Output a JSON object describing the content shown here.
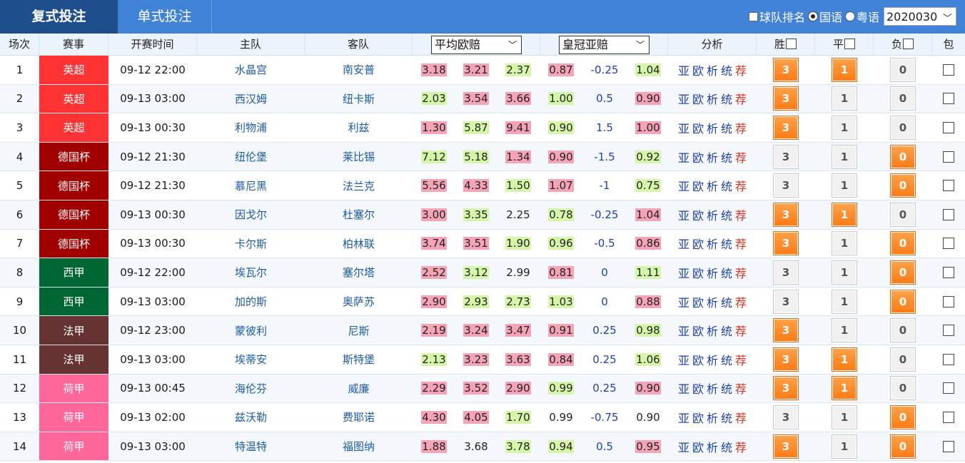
{
  "tabs": {
    "active": "复式投注",
    "inactive": "单式投注"
  },
  "top_right": {
    "team_rank_label": "球队排名",
    "lang_mandarin": "国语",
    "lang_cantonese": "粤语",
    "issue_value": "2020030"
  },
  "headers": {
    "match_no": "场次",
    "league": "赛事",
    "kickoff": "开赛时间",
    "home": "主队",
    "away": "客队",
    "euro_select": "平均欧赔",
    "asia_select": "皇冠亚赔",
    "analysis": "分析",
    "win": "胜",
    "draw": "平",
    "lose": "负",
    "bao": "包"
  },
  "analysis_links": [
    "亚",
    "欧",
    "析",
    "统",
    "荐"
  ],
  "league_colors": {
    "英超": "#ff3333",
    "德国杯": "#a10000",
    "西甲": "#006633",
    "法甲": "#663333",
    "荷甲": "#ff6699"
  },
  "rows": [
    {
      "no": "1",
      "league": "英超",
      "time": "09-12 22:00",
      "home": "水晶宫",
      "away": "南安普",
      "eu": [
        "3.18",
        "3.21",
        "2.37"
      ],
      "eu_hl": [
        "p",
        "p",
        "g"
      ],
      "as": [
        "0.87",
        "-0.25",
        "1.04"
      ],
      "as_hl": [
        "p",
        "g"
      ],
      "win": "3",
      "draw": "1",
      "lose": "0",
      "sel": [
        true,
        true,
        false
      ]
    },
    {
      "no": "2",
      "league": "英超",
      "time": "09-13 03:00",
      "home": "西汉姆",
      "away": "纽卡斯",
      "eu": [
        "2.03",
        "3.54",
        "3.66"
      ],
      "eu_hl": [
        "g",
        "p",
        "p"
      ],
      "as": [
        "1.00",
        "0.5",
        "0.90"
      ],
      "as_hl": [
        "g",
        "p"
      ],
      "win": "3",
      "draw": "1",
      "lose": "0",
      "sel": [
        true,
        false,
        false
      ]
    },
    {
      "no": "3",
      "league": "英超",
      "time": "09-13 00:30",
      "home": "利物浦",
      "away": "利兹",
      "eu": [
        "1.30",
        "5.87",
        "9.41"
      ],
      "eu_hl": [
        "p",
        "g",
        "p"
      ],
      "as": [
        "0.90",
        "1.5",
        "1.00"
      ],
      "as_hl": [
        "g",
        "p"
      ],
      "win": "3",
      "draw": "1",
      "lose": "0",
      "sel": [
        true,
        false,
        false
      ]
    },
    {
      "no": "4",
      "league": "德国杯",
      "time": "09-12 21:30",
      "home": "纽伦堡",
      "away": "莱比锡",
      "eu": [
        "7.12",
        "5.18",
        "1.34"
      ],
      "eu_hl": [
        "g",
        "g",
        "p"
      ],
      "as": [
        "0.90",
        "-1.5",
        "0.92"
      ],
      "as_hl": [
        "p",
        "g"
      ],
      "win": "3",
      "draw": "1",
      "lose": "0",
      "sel": [
        false,
        false,
        true
      ]
    },
    {
      "no": "5",
      "league": "德国杯",
      "time": "09-12 21:30",
      "home": "慕尼黑",
      "away": "法兰克",
      "eu": [
        "5.56",
        "4.33",
        "1.50"
      ],
      "eu_hl": [
        "p",
        "p",
        "g"
      ],
      "as": [
        "1.07",
        "-1",
        "0.75"
      ],
      "as_hl": [
        "p",
        "g"
      ],
      "win": "3",
      "draw": "1",
      "lose": "0",
      "sel": [
        false,
        false,
        true
      ]
    },
    {
      "no": "6",
      "league": "德国杯",
      "time": "09-13 00:30",
      "home": "因戈尔",
      "away": "杜塞尔",
      "eu": [
        "3.00",
        "3.35",
        "2.25"
      ],
      "eu_hl": [
        "p",
        "g",
        ""
      ],
      "as": [
        "0.78",
        "-0.25",
        "1.04"
      ],
      "as_hl": [
        "g",
        "p"
      ],
      "win": "3",
      "draw": "1",
      "lose": "0",
      "sel": [
        true,
        true,
        false
      ]
    },
    {
      "no": "7",
      "league": "德国杯",
      "time": "09-13 00:30",
      "home": "卡尔斯",
      "away": "柏林联",
      "eu": [
        "3.74",
        "3.51",
        "1.90"
      ],
      "eu_hl": [
        "p",
        "p",
        "g"
      ],
      "as": [
        "0.96",
        "-0.5",
        "0.86"
      ],
      "as_hl": [
        "g",
        "p"
      ],
      "win": "3",
      "draw": "1",
      "lose": "0",
      "sel": [
        true,
        false,
        true
      ]
    },
    {
      "no": "8",
      "league": "西甲",
      "time": "09-12 22:00",
      "home": "埃瓦尔",
      "away": "塞尔塔",
      "eu": [
        "2.52",
        "3.12",
        "2.99"
      ],
      "eu_hl": [
        "p",
        "g",
        ""
      ],
      "as": [
        "0.81",
        "0",
        "1.11"
      ],
      "as_hl": [
        "p",
        "g"
      ],
      "win": "3",
      "draw": "1",
      "lose": "0",
      "sel": [
        false,
        false,
        true
      ]
    },
    {
      "no": "9",
      "league": "西甲",
      "time": "09-13 03:00",
      "home": "加的斯",
      "away": "奥萨苏",
      "eu": [
        "2.90",
        "2.93",
        "2.73"
      ],
      "eu_hl": [
        "p",
        "g",
        "g"
      ],
      "as": [
        "1.03",
        "0",
        "0.88"
      ],
      "as_hl": [
        "g",
        "p"
      ],
      "win": "3",
      "draw": "1",
      "lose": "0",
      "sel": [
        false,
        false,
        true
      ]
    },
    {
      "no": "10",
      "league": "法甲",
      "time": "09-12 23:00",
      "home": "蒙彼利",
      "away": "尼斯",
      "eu": [
        "2.19",
        "3.24",
        "3.47"
      ],
      "eu_hl": [
        "p",
        "p",
        "p"
      ],
      "as": [
        "0.91",
        "0.25",
        "0.98"
      ],
      "as_hl": [
        "p",
        "g"
      ],
      "win": "3",
      "draw": "1",
      "lose": "0",
      "sel": [
        true,
        false,
        false
      ]
    },
    {
      "no": "11",
      "league": "法甲",
      "time": "09-13 03:00",
      "home": "埃蒂安",
      "away": "斯特堡",
      "eu": [
        "2.13",
        "3.23",
        "3.63"
      ],
      "eu_hl": [
        "g",
        "p",
        "p"
      ],
      "as": [
        "0.84",
        "0.25",
        "1.06"
      ],
      "as_hl": [
        "p",
        "g"
      ],
      "win": "3",
      "draw": "1",
      "lose": "0",
      "sel": [
        true,
        true,
        false
      ]
    },
    {
      "no": "12",
      "league": "荷甲",
      "time": "09-13 00:45",
      "home": "海伦芬",
      "away": "威廉",
      "eu": [
        "2.29",
        "3.52",
        "2.90"
      ],
      "eu_hl": [
        "p",
        "p",
        "p"
      ],
      "as": [
        "0.99",
        "0.25",
        "0.90"
      ],
      "as_hl": [
        "g",
        "p"
      ],
      "win": "3",
      "draw": "1",
      "lose": "0",
      "sel": [
        true,
        true,
        false
      ]
    },
    {
      "no": "13",
      "league": "荷甲",
      "time": "09-13 02:00",
      "home": "兹沃勒",
      "away": "费耶诺",
      "eu": [
        "4.30",
        "4.05",
        "1.70"
      ],
      "eu_hl": [
        "p",
        "p",
        "g"
      ],
      "as": [
        "0.99",
        "-0.75",
        "0.90"
      ],
      "as_hl": [
        "",
        ""
      ],
      "win": "3",
      "draw": "1",
      "lose": "0",
      "sel": [
        false,
        false,
        true
      ]
    },
    {
      "no": "14",
      "league": "荷甲",
      "time": "09-13 03:00",
      "home": "特温特",
      "away": "福图纳",
      "eu": [
        "1.88",
        "3.68",
        "3.78"
      ],
      "eu_hl": [
        "p",
        "",
        "g"
      ],
      "as": [
        "0.94",
        "0.5",
        "0.95"
      ],
      "as_hl": [
        "g",
        "p"
      ],
      "win": "3",
      "draw": "1",
      "lose": "0",
      "sel": [
        true,
        false,
        true
      ]
    }
  ]
}
